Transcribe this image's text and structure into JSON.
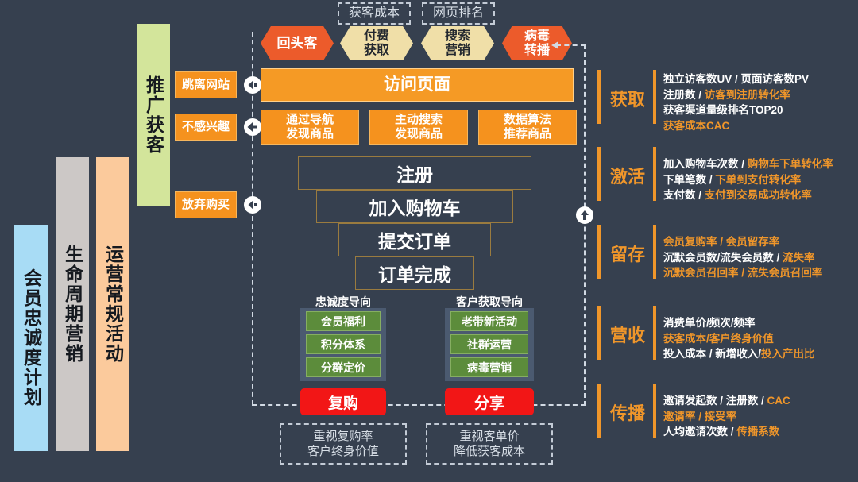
{
  "meta": {
    "bg_color": "#36404F",
    "accent_orange": "#F0962A",
    "accent_red": "#F21616",
    "accent_green": "#5C8C3B"
  },
  "category_bars": [
    {
      "label": "会员忠诚度计划",
      "color": "#A8DCF5"
    },
    {
      "label": "生命周期营销",
      "color": "#CCC8C6"
    },
    {
      "label": "运营常规活动",
      "color": "#FBCA9C"
    },
    {
      "label": "推广获客",
      "color": "#D3E59B"
    }
  ],
  "exit_boxes": [
    {
      "label": "跳离网站"
    },
    {
      "label": "不感兴趣"
    },
    {
      "label": "放弃购买"
    }
  ],
  "top_notes": [
    {
      "label": "获客成本"
    },
    {
      "label": "网页排名"
    }
  ],
  "channels": [
    {
      "label": "回头客",
      "style": "red"
    },
    {
      "label": "付费\n获取",
      "line1": "付费",
      "line2": "获取",
      "style": "tan"
    },
    {
      "label": "搜索\n营销",
      "line1": "搜索",
      "line2": "营销",
      "style": "tan"
    },
    {
      "label": "病毒\n转播",
      "line1": "病毒",
      "line2": "转播",
      "style": "red"
    }
  ],
  "visit_page": {
    "label": "访问页面"
  },
  "discovery": [
    {
      "line1": "通过导航",
      "line2": "发现商品"
    },
    {
      "line1": "主动搜索",
      "line2": "发现商品"
    },
    {
      "line1": "数据算法",
      "line2": "推荐商品"
    }
  ],
  "funnel": [
    {
      "label": "注册"
    },
    {
      "label": "加入购物车"
    },
    {
      "label": "提交订单"
    },
    {
      "label": "订单完成"
    }
  ],
  "groups": [
    {
      "title": "忠诚度导向",
      "items": [
        "会员福利",
        "积分体系",
        "分群定价"
      ],
      "cta": "复购",
      "note_line1": "重视复购率",
      "note_line2": "客户终身价值"
    },
    {
      "title": "客户获取导向",
      "items": [
        "老带新活动",
        "社群运营",
        "病毒营销"
      ],
      "cta": "分享",
      "note_line1": "重视客单价",
      "note_line2": "降低获客成本"
    }
  ],
  "metrics": [
    {
      "stage": "获取",
      "lines": [
        [
          {
            "t": "独立访客数UV / 页面访客数PV",
            "c": "w"
          }
        ],
        [
          {
            "t": "注册数 / ",
            "c": "w"
          },
          {
            "t": "访客到注册转化率",
            "c": "o"
          }
        ],
        [
          {
            "t": "获客渠道量级排名TOP20",
            "c": "w"
          }
        ],
        [
          {
            "t": "获客成本CAC",
            "c": "o"
          }
        ]
      ]
    },
    {
      "stage": "激活",
      "lines": [
        [
          {
            "t": "加入购物车次数 / ",
            "c": "w"
          },
          {
            "t": "购物车下单转化率",
            "c": "o"
          }
        ],
        [
          {
            "t": "下单笔数 / ",
            "c": "w"
          },
          {
            "t": "下单到支付转化率",
            "c": "o"
          }
        ],
        [
          {
            "t": "支付数 / ",
            "c": "w"
          },
          {
            "t": "支付到交易成功转化率",
            "c": "o"
          }
        ]
      ]
    },
    {
      "stage": "留存",
      "lines": [
        [
          {
            "t": "会员复购率 / 会员留存率",
            "c": "o"
          }
        ],
        [
          {
            "t": "沉默会员数/流失会员数 / ",
            "c": "w"
          },
          {
            "t": "流失率",
            "c": "o"
          }
        ],
        [
          {
            "t": "沉默会员召回率 / 流失会员召回率",
            "c": "o"
          }
        ]
      ]
    },
    {
      "stage": "营收",
      "lines": [
        [
          {
            "t": "消费单价/频次/频率",
            "c": "w"
          }
        ],
        [
          {
            "t": "获客成本/客户终身价值",
            "c": "o"
          }
        ],
        [
          {
            "t": "投入成本 / 新增收入/",
            "c": "w"
          },
          {
            "t": "投入产出比",
            "c": "o"
          }
        ]
      ]
    },
    {
      "stage": "传播",
      "lines": [
        [
          {
            "t": "邀请发起数 / 注册数 / ",
            "c": "w"
          },
          {
            "t": "CAC",
            "c": "o"
          }
        ],
        [
          {
            "t": "邀请率 / 接受率",
            "c": "o"
          }
        ],
        [
          {
            "t": "人均邀请次数 / ",
            "c": "w"
          },
          {
            "t": "传播系数",
            "c": "o"
          }
        ]
      ]
    }
  ],
  "icons": {
    "exit_marker": "circle-left-arrow-icon",
    "loop_marker": "circle-up-arrow-icon"
  }
}
